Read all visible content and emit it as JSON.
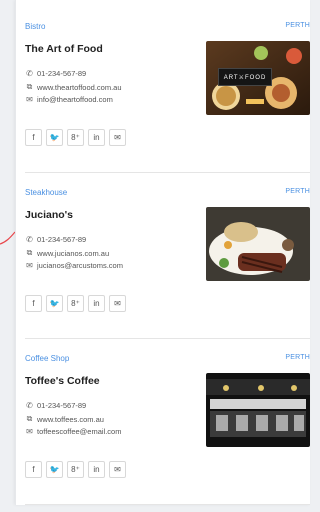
{
  "listings": [
    {
      "category": "Bistro",
      "location": "PERTH",
      "name": "The Art of Food",
      "phone": "01-234-567-89",
      "website": "www.theartoffood.com.au",
      "email": "info@theartoffood.com",
      "image_logo_text": "ART⚔FOOD"
    },
    {
      "category": "Steakhouse",
      "location": "PERTH",
      "name": "Juciano's",
      "phone": "01-234-567-89",
      "website": "www.jucianos.com.au",
      "email": "jucianos@arcustoms.com"
    },
    {
      "category": "Coffee Shop",
      "location": "PERTH",
      "name": "Toffee's Coffee",
      "phone": "01-234-567-89",
      "website": "www.toffees.com.au",
      "email": "toffeescoffee@email.com"
    }
  ],
  "social": {
    "facebook": "f",
    "twitter": "🐦",
    "googleplus": "8⁺",
    "linkedin": "in",
    "email": "✉"
  },
  "colors": {
    "accent": "#4a90e2",
    "accent_line": "#e8464b"
  },
  "icons": [
    "phone-icon",
    "external-link-icon",
    "envelope-icon"
  ]
}
